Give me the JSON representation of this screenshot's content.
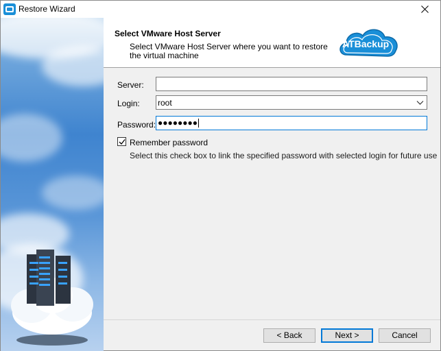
{
  "window": {
    "title": "Restore Wizard"
  },
  "header": {
    "title": "Select VMware Host Server",
    "description": "Select VMware Host Server where you want to restore the virtual machine",
    "logo_text": "ATBackup"
  },
  "form": {
    "server": {
      "label": "Server:",
      "value": ""
    },
    "login": {
      "label": "Login:",
      "value": "root"
    },
    "password": {
      "label": "Password:",
      "masked_value": "●●●●●●●●"
    },
    "remember": {
      "label": "Remember password",
      "checked": true,
      "hint": "Select this check box to link the specified password with selected login for future use"
    }
  },
  "buttons": {
    "back": "< Back",
    "next": "Next >",
    "cancel": "Cancel"
  },
  "colors": {
    "accent": "#0078d7",
    "logo_blue": "#1a8fd8",
    "sky": "#3f84cf"
  }
}
